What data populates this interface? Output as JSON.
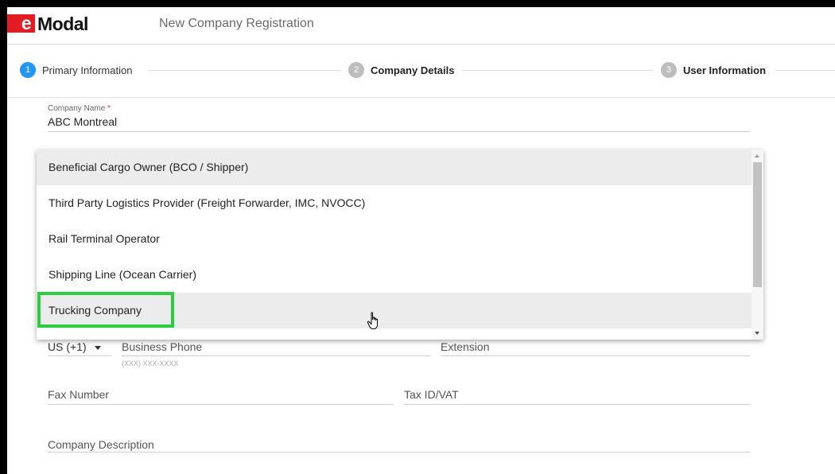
{
  "header": {
    "logo_e": "e",
    "logo_rest": "Modal",
    "title": "New Company Registration"
  },
  "steps": [
    {
      "num": "1",
      "label": "Primary Information",
      "state": "active"
    },
    {
      "num": "2",
      "label": "Company Details",
      "state": "inactive"
    },
    {
      "num": "3",
      "label": "User Information",
      "state": "inactive"
    }
  ],
  "form": {
    "company_name_label": "Company Name",
    "company_name_required": "*",
    "company_name_value": "ABC Montreal",
    "country_code": "US (+1)",
    "business_phone_placeholder": "Business Phone",
    "business_phone_hint": "(XXX) XXX-XXXX",
    "extension_placeholder": "Extension",
    "fax_placeholder": "Fax Number",
    "tax_placeholder": "Tax ID/VAT",
    "description_placeholder": "Company Description"
  },
  "company_type_dropdown": {
    "options": [
      "Beneficial Cargo Owner (BCO / Shipper)",
      "Third Party Logistics Provider (Freight Forwarder, IMC, NVOCC)",
      "Rail Terminal Operator",
      "Shipping Line (Ocean Carrier)",
      "Trucking Company"
    ],
    "hovered_option": "Trucking Company",
    "highlight_color": "#2ecc40"
  },
  "colors": {
    "brand_red": "#e31b23",
    "active_step": "#2196f3",
    "inactive_step": "#bdbdbd"
  }
}
